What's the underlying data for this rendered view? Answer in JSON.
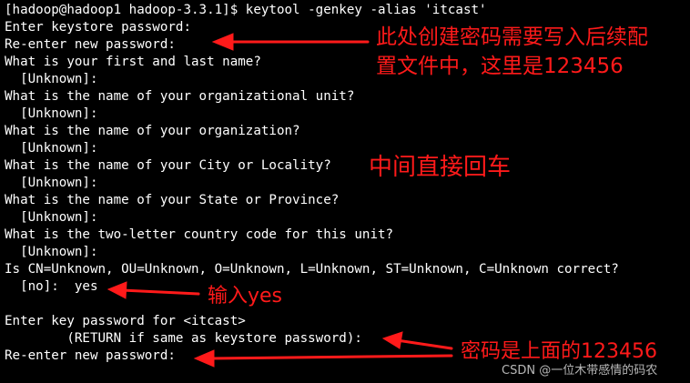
{
  "terminal": {
    "lines": [
      "[hadoop@hadoop1 hadoop-3.3.1]$ keytool -genkey -alias 'itcast'",
      "Enter keystore password:",
      "Re-enter new password:",
      "What is your first and last name?",
      "  [Unknown]:",
      "What is the name of your organizational unit?",
      "  [Unknown]:",
      "What is the name of your organization?",
      "  [Unknown]:",
      "What is the name of your City or Locality?",
      "  [Unknown]:",
      "What is the name of your State or Province?",
      "  [Unknown]:",
      "What is the two-letter country code for this unit?",
      "  [Unknown]:",
      "Is CN=Unknown, OU=Unknown, O=Unknown, L=Unknown, ST=Unknown, C=Unknown correct?",
      "  [no]:  yes",
      "",
      "Enter key password for <itcast>",
      "        (RETURN if same as keystore password):",
      "Re-enter new password:"
    ]
  },
  "annotations": {
    "note1_line1": "此处创建密码需要写入后续配",
    "note1_line2": "置文件中，这里是123456",
    "note2": "中间直接回车",
    "note3": "输入yes",
    "note4": "密码是上面的123456"
  },
  "watermark": "CSDN @一位木带感情的码农",
  "colors": {
    "background": "#000000",
    "text": "#ffffff",
    "annotation": "#ff1a1a"
  }
}
